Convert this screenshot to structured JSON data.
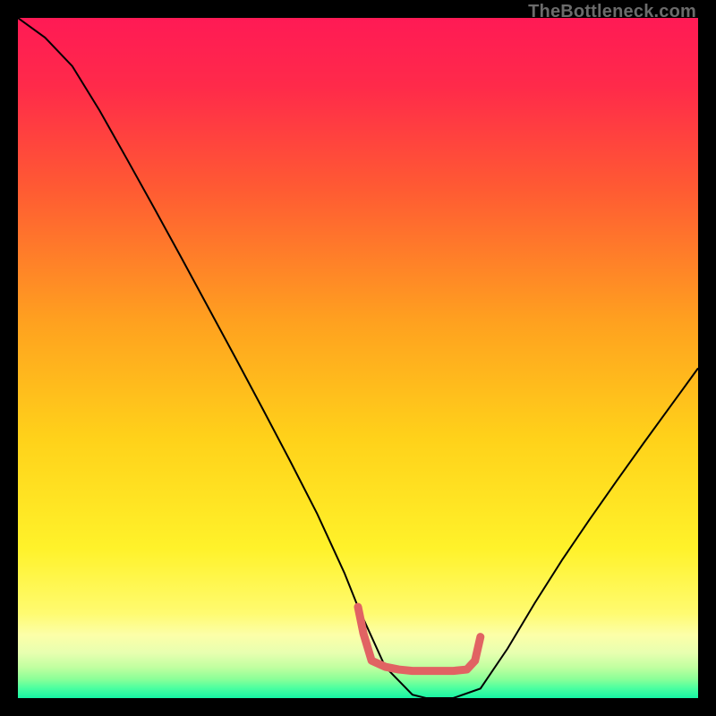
{
  "watermark": "TheBottleneck.com",
  "chart_data": {
    "type": "line",
    "title": "",
    "xlabel": "",
    "ylabel": "",
    "xlim": [
      0,
      100
    ],
    "ylim": [
      0,
      100
    ],
    "grid": false,
    "legend": false,
    "background_gradient": {
      "stops": [
        {
          "offset": 0.0,
          "color": "#ff1a55"
        },
        {
          "offset": 0.1,
          "color": "#ff2a4a"
        },
        {
          "offset": 0.25,
          "color": "#ff5a33"
        },
        {
          "offset": 0.45,
          "color": "#ffa21f"
        },
        {
          "offset": 0.62,
          "color": "#ffd21a"
        },
        {
          "offset": 0.78,
          "color": "#fff22a"
        },
        {
          "offset": 0.875,
          "color": "#fffb70"
        },
        {
          "offset": 0.907,
          "color": "#fcffa8"
        },
        {
          "offset": 0.933,
          "color": "#e8ffb0"
        },
        {
          "offset": 0.955,
          "color": "#c0ffa0"
        },
        {
          "offset": 0.972,
          "color": "#8bff98"
        },
        {
          "offset": 0.985,
          "color": "#4dffa0"
        },
        {
          "offset": 1.0,
          "color": "#16f5a4"
        }
      ]
    },
    "series": [
      {
        "name": "bottleneck-curve",
        "stroke": "#000000",
        "stroke_width": 2,
        "x": [
          0,
          4,
          8,
          12,
          16,
          20,
          24,
          28,
          32,
          36,
          40,
          44,
          48,
          50,
          54,
          58,
          60,
          64,
          68,
          72,
          76,
          80,
          84,
          88,
          92,
          96,
          100
        ],
        "y": [
          100,
          97.1,
          92.9,
          86.4,
          79.3,
          72.1,
          64.8,
          57.4,
          50.0,
          42.5,
          34.9,
          27.1,
          18.4,
          13.4,
          4.6,
          0.5,
          0.0,
          0.0,
          1.4,
          7.3,
          14.0,
          20.3,
          26.2,
          31.9,
          37.5,
          43.0,
          48.5
        ]
      },
      {
        "name": "sweet-spot-highlight",
        "stroke": "#e16363",
        "stroke_width": 9,
        "linecap": "round",
        "x": [
          50,
          50.8,
          52,
          54,
          56,
          58,
          60,
          62,
          64,
          66,
          67.2,
          68
        ],
        "y": [
          13.4,
          9.5,
          5.5,
          4.6,
          4.2,
          4.0,
          4.0,
          4.0,
          4.0,
          4.2,
          5.5,
          9.0
        ]
      }
    ]
  }
}
